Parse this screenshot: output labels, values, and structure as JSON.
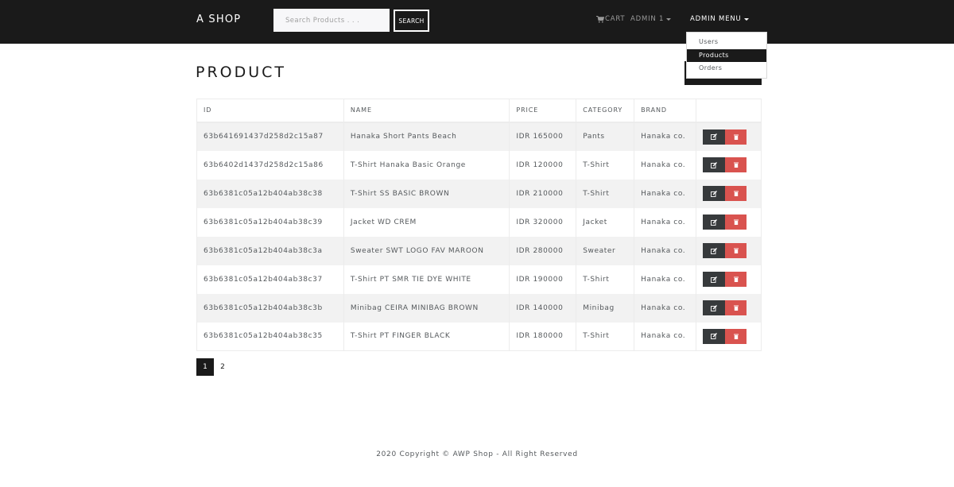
{
  "navbar": {
    "brand": "A SHOP",
    "search_placeholder": "Search Products . . .",
    "search_label": "SEARCH",
    "cart_label": "CART",
    "admin_label": "ADMIN 1",
    "admin_menu_label": "ADMIN MENU"
  },
  "dropdown": {
    "items": [
      {
        "label": "Users"
      },
      {
        "label": "Products"
      },
      {
        "label": "Orders"
      }
    ]
  },
  "page": {
    "title": "PRODUCT"
  },
  "table": {
    "headers": [
      "ID",
      "NAME",
      "PRICE",
      "CATEGORY",
      "BRAND",
      ""
    ],
    "rows": [
      {
        "id": "63b641691437d258d2c15a87",
        "name": "Hanaka Short Pants Beach",
        "price": "IDR 165000",
        "category": "Pants",
        "brand": "Hanaka co."
      },
      {
        "id": "63b6402d1437d258d2c15a86",
        "name": "T-Shirt Hanaka Basic Orange",
        "price": "IDR 120000",
        "category": "T-Shirt",
        "brand": "Hanaka co."
      },
      {
        "id": "63b6381c05a12b404ab38c38",
        "name": "T-Shirt SS BASIC BROWN",
        "price": "IDR 210000",
        "category": "T-Shirt",
        "brand": "Hanaka co."
      },
      {
        "id": "63b6381c05a12b404ab38c39",
        "name": "Jacket WD CREM",
        "price": "IDR 320000",
        "category": "Jacket",
        "brand": "Hanaka co."
      },
      {
        "id": "63b6381c05a12b404ab38c3a",
        "name": "Sweater SWT LOGO FAV MAROON",
        "price": "IDR 280000",
        "category": "Sweater",
        "brand": "Hanaka co."
      },
      {
        "id": "63b6381c05a12b404ab38c37",
        "name": "T-Shirt PT SMR TIE DYE WHITE",
        "price": "IDR 190000",
        "category": "T-Shirt",
        "brand": "Hanaka co."
      },
      {
        "id": "63b6381c05a12b404ab38c3b",
        "name": "Minibag CEIRA MINIBAG BROWN",
        "price": "IDR 140000",
        "category": "Minibag",
        "brand": "Hanaka co."
      },
      {
        "id": "63b6381c05a12b404ab38c35",
        "name": "T-Shirt PT FINGER BLACK",
        "price": "IDR 180000",
        "category": "T-Shirt",
        "brand": "Hanaka co."
      }
    ]
  },
  "pagination": {
    "pages": [
      "1",
      "2"
    ],
    "current": "1"
  },
  "footer": {
    "text": "2020 Copyright © AWP Shop - All Right Reserved"
  },
  "colors": {
    "navbar": "#1a1a1a",
    "edit": "#373a3c",
    "delete": "#d9534f",
    "stripe": "#f2f2f2"
  },
  "icons": {
    "cart": "shopping-cart-icon",
    "edit": "edit-icon",
    "delete": "trash-icon"
  }
}
